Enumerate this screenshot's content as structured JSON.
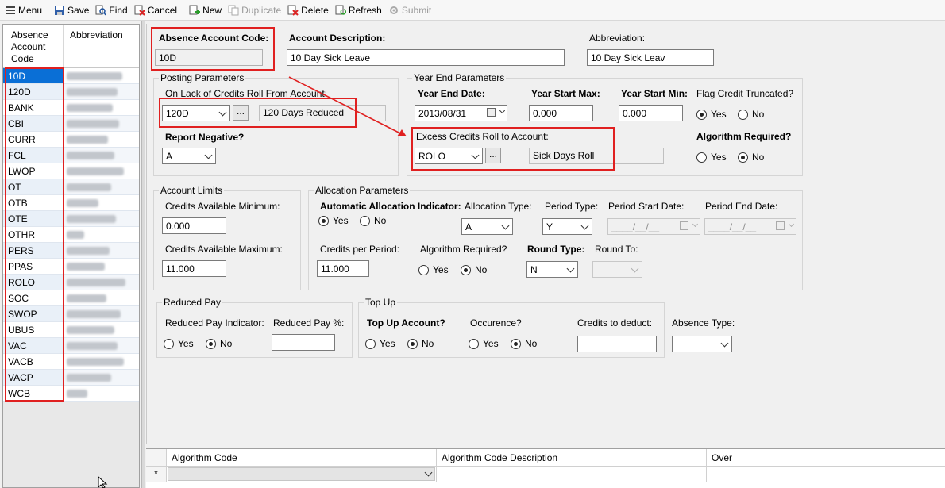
{
  "toolbar": {
    "menu": "Menu",
    "save": "Save",
    "find": "Find",
    "cancel": "Cancel",
    "new": "New",
    "duplicate": "Duplicate",
    "delete": "Delete",
    "refresh": "Refresh",
    "submit": "Submit"
  },
  "list": {
    "header_code": "Absence Account Code",
    "header_abbr": "Abbreviation",
    "rows": [
      "10D",
      "120D",
      "BANK",
      "CBI",
      "CURR",
      "FCL",
      "LWOP",
      "OT",
      "OTB",
      "OTE",
      "OTHR",
      "PERS",
      "PPAS",
      "ROLO",
      "SOC",
      "SWOP",
      "UBUS",
      "VAC",
      "VACB",
      "VACP",
      "WCB"
    ]
  },
  "header": {
    "code_label": "Absence Account Code:",
    "code_value": "10D",
    "desc_label": "Account Description:",
    "desc_value": "10 Day Sick Leave",
    "abbr_label": "Abbreviation:",
    "abbr_value": "10 Day Sick Leav"
  },
  "posting": {
    "title": "Posting Parameters",
    "roll_from_label": "On Lack of Credits Roll From Account:",
    "roll_from_value": "120D",
    "roll_from_desc": "120 Days Reduced",
    "report_negative_label": "Report Negative?",
    "report_negative_value": "A",
    "dots": "..."
  },
  "year_end": {
    "title": "Year End Parameters",
    "end_date_label": "Year End Date:",
    "end_date_value": "2013/08/31",
    "start_max_label": "Year Start Max:",
    "start_max_value": "0.000",
    "start_min_label": "Year Start Min:",
    "start_min_value": "0.000",
    "flag_label": "Flag Credit Truncated?",
    "yes": "Yes",
    "no": "No",
    "excess_label": "Excess Credits Roll to Account:",
    "excess_value": "ROLO",
    "excess_desc": "Sick Days Roll",
    "algo_required_label": "Algorithm Required?"
  },
  "limits": {
    "title": "Account Limits",
    "min_label": "Credits Available Minimum:",
    "min_value": "0.000",
    "max_label": "Credits Available Maximum:",
    "max_value": "11.000"
  },
  "allocation": {
    "title": "Allocation Parameters",
    "auto_label": "Automatic Allocation Indicator:",
    "type_label": "Allocation Type:",
    "type_value": "A",
    "period_type_label": "Period Type:",
    "period_type_value": "Y",
    "period_start_label": "Period Start Date:",
    "period_start_value": "____/__/__",
    "period_end_label": "Period End Date:",
    "period_end_value": "____/__/__",
    "per_period_label": "Credits per Period:",
    "per_period_value": "11.000",
    "algo_label": "Algorithm Required?",
    "round_type_label": "Round Type:",
    "round_type_value": "N",
    "round_to_label": "Round To:"
  },
  "reduced": {
    "title": "Reduced Pay",
    "indicator_label": "Reduced Pay Indicator:",
    "pct_label": "Reduced Pay %:"
  },
  "topup": {
    "title": "Top Up",
    "account_label": "Top Up Account?",
    "occurence_label": "Occurence?",
    "deduct_label": "Credits to deduct:"
  },
  "absence_type_label": "Absence Type:",
  "grid": {
    "col1": "Algorithm Code",
    "col2": "Algorithm Code Description",
    "col3": "Over",
    "new_row_marker": "*"
  },
  "colors": {
    "selection": "#0a6fd6",
    "highlight": "#e02020"
  }
}
